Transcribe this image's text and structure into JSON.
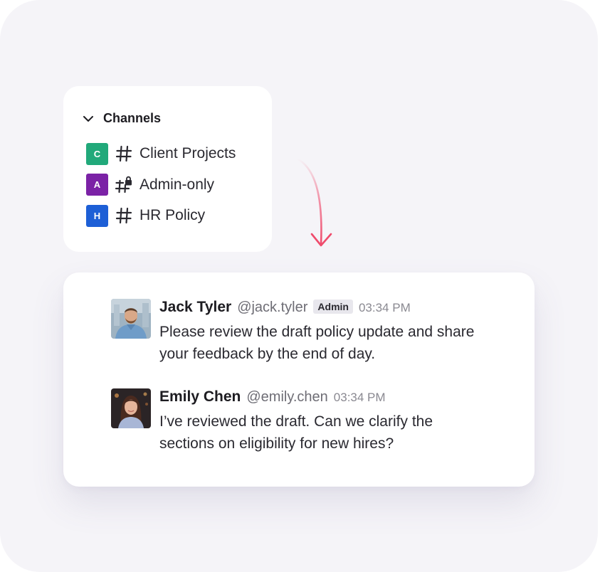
{
  "channels": {
    "title": "Channels",
    "items": [
      {
        "badge": "C",
        "badge_color": "#21a97a",
        "label": "Client Projects",
        "icon": "hash-icon",
        "private": false
      },
      {
        "badge": "A",
        "badge_color": "#7b22a6",
        "label": "Admin-only",
        "icon": "hash-lock-icon",
        "private": true
      },
      {
        "badge": "H",
        "badge_color": "#1d5fd6",
        "label": "HR Policy",
        "icon": "hash-icon",
        "private": false
      }
    ]
  },
  "arrow": {
    "color": "#ef4b6c"
  },
  "messages": [
    {
      "name": "Jack Tyler",
      "handle": "@jack.tyler",
      "badge": "Admin",
      "time": "03:34 PM",
      "text": "Please review the draft policy update and share your feedback by the end of day."
    },
    {
      "name": "Emily Chen",
      "handle": "@emily.chen",
      "time": "03:34 PM",
      "text": "I’ve reviewed the draft. Can we clarify the sections on eligibility for new hires?"
    }
  ]
}
